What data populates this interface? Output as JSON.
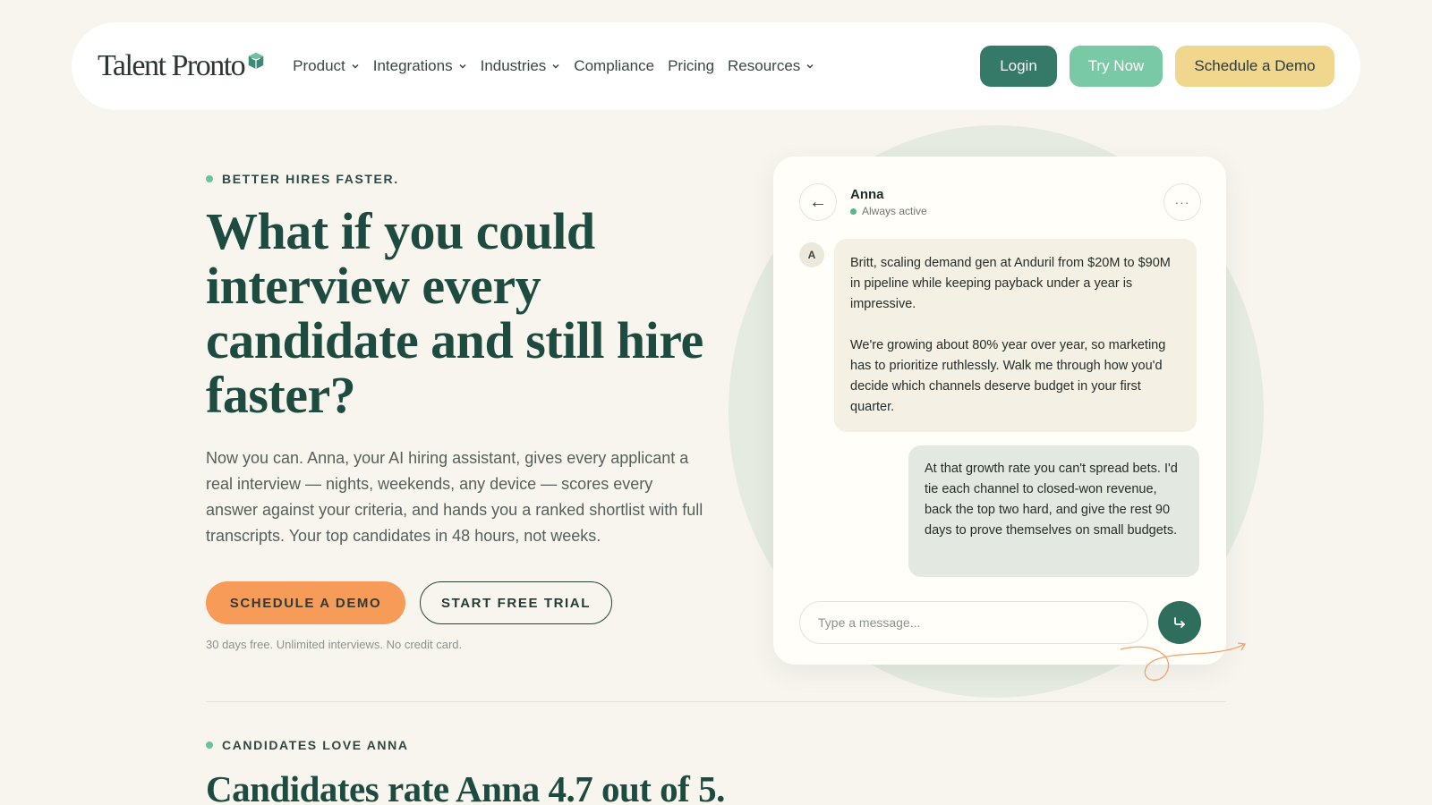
{
  "nav": {
    "logo_text": "Talent Pronto",
    "items": [
      {
        "label": "Product",
        "dropdown": true
      },
      {
        "label": "Integrations",
        "dropdown": true
      },
      {
        "label": "Industries",
        "dropdown": true
      },
      {
        "label": "Compliance",
        "dropdown": false
      },
      {
        "label": "Pricing",
        "dropdown": false
      },
      {
        "label": "Resources",
        "dropdown": true
      }
    ],
    "login_label": "Login",
    "try_label": "Try Now",
    "demo_label": "Schedule a Demo"
  },
  "hero": {
    "eyebrow": "BETTER HIRES FASTER.",
    "title": "What if you could interview every candidate and still hire faster?",
    "description": "Now you can. Anna, your AI hiring assistant, gives every applicant a real interview — nights, weekends, any device — scores every answer against your criteria, and hands you a ranked shortlist with full transcripts. Your top candidates in 48 hours, not weeks.",
    "schedule_label": "SCHEDULE A DEMO",
    "trial_label": "START FREE TRIAL",
    "fineprint": "30 days free. Unlimited interviews. No credit card."
  },
  "chat": {
    "back_icon": "←",
    "name": "Anna",
    "status": "Always active",
    "more_icon": "···",
    "avatar_initial": "A",
    "incoming_p1": "Britt, scaling demand gen at Anduril from $20M to $90M in pipeline while keeping payback under a year is impressive.",
    "incoming_p2": "We're growing about 80% year over year, so marketing has to prioritize ruthlessly. Walk me through how you'd decide which channels deserve budget in your first quarter.",
    "outgoing": "At that growth rate you can't spread bets. I'd tie each channel to closed-won revenue, back the top two hard, and give the rest 90 days to prove themselves on small budgets.",
    "input_value": "",
    "input_placeholder": "Type a message..."
  },
  "section2": {
    "eyebrow": "CANDIDATES LOVE ANNA",
    "title": "Candidates rate Anna 4.7 out of 5."
  },
  "colors": {
    "primary_green": "#357a68",
    "mint": "#79c8a6",
    "butter": "#f1d78e",
    "orange": "#f79b58",
    "heading": "#1d4b3f",
    "background": "#f8f5ef"
  },
  "icons": {
    "chevron": "chevron-down-icon",
    "back": "arrow-left-icon",
    "more": "more-horizontal-icon",
    "send": "send-icon",
    "logo_mark": "cube-icon"
  }
}
